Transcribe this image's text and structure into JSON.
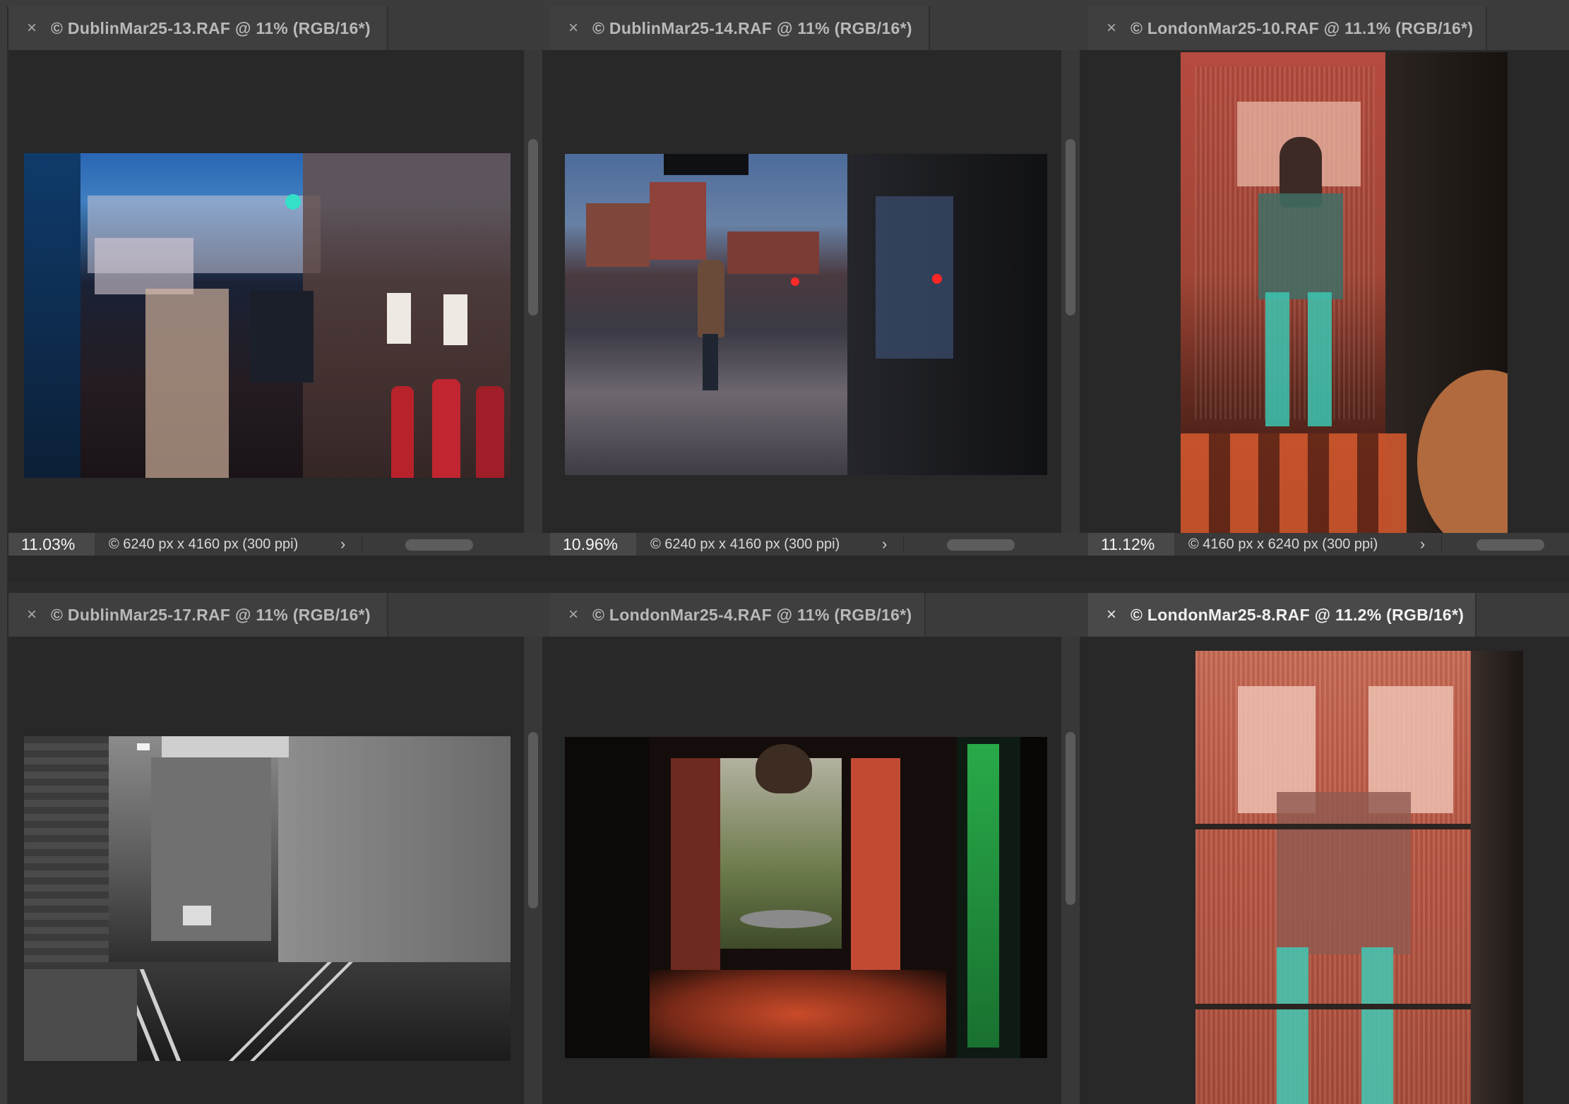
{
  "windows": [
    {
      "title": "© DublinMar25-13.RAF @ 11% (RGB/16*)",
      "zoom": "11.03%",
      "doc_info": "© 6240 px x 4160 px (300 ppi)",
      "active": false
    },
    {
      "title": "© DublinMar25-14.RAF @ 11% (RGB/16*)",
      "zoom": "10.96%",
      "doc_info": "© 6240 px x 4160 px (300 ppi)",
      "active": false
    },
    {
      "title": "© LondonMar25-10.RAF @ 11.1% (RGB/16*)",
      "zoom": "11.12%",
      "doc_info": "© 4160 px x 6240 px (300 ppi)",
      "active": false
    },
    {
      "title": "© DublinMar25-17.RAF @ 11% (RGB/16*)",
      "active": false
    },
    {
      "title": "© LondonMar25-4.RAF @ 11% (RGB/16*)",
      "active": false
    },
    {
      "title": "© LondonMar25-8.RAF @ 11.2% (RGB/16*)",
      "active": true
    }
  ],
  "icons": {
    "close": "close-icon",
    "chevron": "chevron-right-icon"
  },
  "glyphs": {
    "close": "×",
    "chevron": "›"
  },
  "colors": {
    "panel_bg": "#282828",
    "tab_bg": "#3f3f3f",
    "active_tab_bg": "#494949",
    "status_bg": "#3a3a3a"
  }
}
